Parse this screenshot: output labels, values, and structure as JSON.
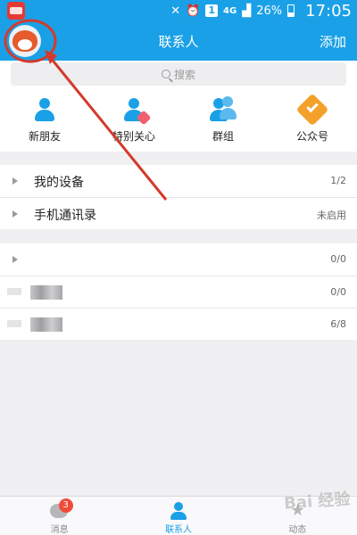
{
  "status_bar": {
    "battery": "26%",
    "network": "4G",
    "sim_slot": "1",
    "time": "17:05"
  },
  "header": {
    "title": "联系人",
    "add": "添加"
  },
  "search": {
    "placeholder": "搜索"
  },
  "quick_entries": [
    {
      "label": "新朋友",
      "icon": "person-icon"
    },
    {
      "label": "特别关心",
      "icon": "person-heart-icon"
    },
    {
      "label": "群组",
      "icon": "group-icon"
    },
    {
      "label": "公众号",
      "icon": "badge-check-icon"
    }
  ],
  "groups": [
    {
      "label": "我的设备",
      "count": "1/2"
    },
    {
      "label": "手机通讯录",
      "count": "未启用"
    }
  ],
  "friend_groups": [
    {
      "label": "",
      "count": "0/0"
    },
    {
      "label": "",
      "count": "0/0"
    },
    {
      "label": "",
      "count": "6/8"
    }
  ],
  "bottom_nav": [
    {
      "label": "消息",
      "badge": "3",
      "icon": "message-icon"
    },
    {
      "label": "联系人",
      "icon": "contacts-icon",
      "active": true
    },
    {
      "label": "动态",
      "icon": "star-icon"
    }
  ],
  "colors": {
    "accent": "#1aa0e6",
    "annotation": "#d33a2c",
    "badge": "#f04b3b"
  }
}
